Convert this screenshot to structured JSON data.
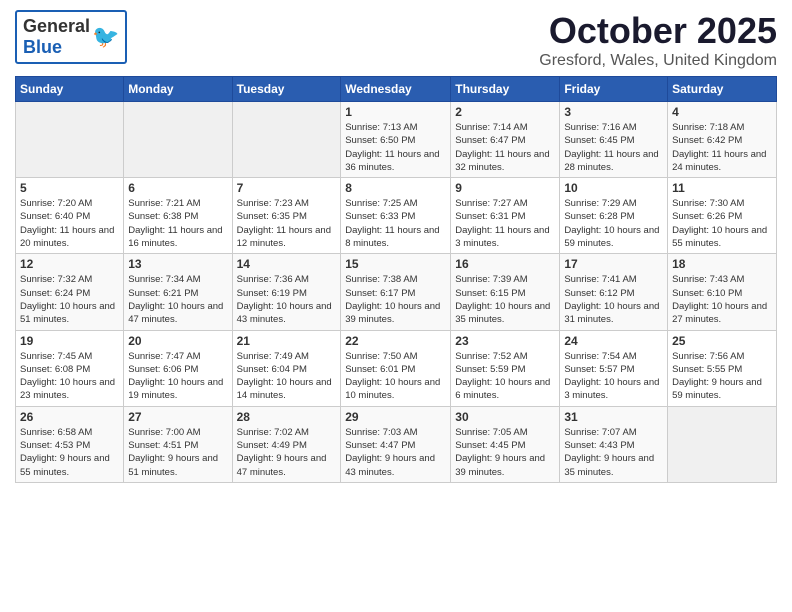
{
  "header": {
    "logo": {
      "general": "General",
      "blue": "Blue"
    },
    "title": "October 2025",
    "location": "Gresford, Wales, United Kingdom"
  },
  "weekdays": [
    "Sunday",
    "Monday",
    "Tuesday",
    "Wednesday",
    "Thursday",
    "Friday",
    "Saturday"
  ],
  "weeks": [
    [
      {
        "day": "",
        "empty": true
      },
      {
        "day": "",
        "empty": true
      },
      {
        "day": "",
        "empty": true
      },
      {
        "day": "1",
        "sunrise": "7:13 AM",
        "sunset": "6:50 PM",
        "daylight": "11 hours and 36 minutes."
      },
      {
        "day": "2",
        "sunrise": "7:14 AM",
        "sunset": "6:47 PM",
        "daylight": "11 hours and 32 minutes."
      },
      {
        "day": "3",
        "sunrise": "7:16 AM",
        "sunset": "6:45 PM",
        "daylight": "11 hours and 28 minutes."
      },
      {
        "day": "4",
        "sunrise": "7:18 AM",
        "sunset": "6:42 PM",
        "daylight": "11 hours and 24 minutes."
      }
    ],
    [
      {
        "day": "5",
        "sunrise": "7:20 AM",
        "sunset": "6:40 PM",
        "daylight": "11 hours and 20 minutes."
      },
      {
        "day": "6",
        "sunrise": "7:21 AM",
        "sunset": "6:38 PM",
        "daylight": "11 hours and 16 minutes."
      },
      {
        "day": "7",
        "sunrise": "7:23 AM",
        "sunset": "6:35 PM",
        "daylight": "11 hours and 12 minutes."
      },
      {
        "day": "8",
        "sunrise": "7:25 AM",
        "sunset": "6:33 PM",
        "daylight": "11 hours and 8 minutes."
      },
      {
        "day": "9",
        "sunrise": "7:27 AM",
        "sunset": "6:31 PM",
        "daylight": "11 hours and 3 minutes."
      },
      {
        "day": "10",
        "sunrise": "7:29 AM",
        "sunset": "6:28 PM",
        "daylight": "10 hours and 59 minutes."
      },
      {
        "day": "11",
        "sunrise": "7:30 AM",
        "sunset": "6:26 PM",
        "daylight": "10 hours and 55 minutes."
      }
    ],
    [
      {
        "day": "12",
        "sunrise": "7:32 AM",
        "sunset": "6:24 PM",
        "daylight": "10 hours and 51 minutes."
      },
      {
        "day": "13",
        "sunrise": "7:34 AM",
        "sunset": "6:21 PM",
        "daylight": "10 hours and 47 minutes."
      },
      {
        "day": "14",
        "sunrise": "7:36 AM",
        "sunset": "6:19 PM",
        "daylight": "10 hours and 43 minutes."
      },
      {
        "day": "15",
        "sunrise": "7:38 AM",
        "sunset": "6:17 PM",
        "daylight": "10 hours and 39 minutes."
      },
      {
        "day": "16",
        "sunrise": "7:39 AM",
        "sunset": "6:15 PM",
        "daylight": "10 hours and 35 minutes."
      },
      {
        "day": "17",
        "sunrise": "7:41 AM",
        "sunset": "6:12 PM",
        "daylight": "10 hours and 31 minutes."
      },
      {
        "day": "18",
        "sunrise": "7:43 AM",
        "sunset": "6:10 PM",
        "daylight": "10 hours and 27 minutes."
      }
    ],
    [
      {
        "day": "19",
        "sunrise": "7:45 AM",
        "sunset": "6:08 PM",
        "daylight": "10 hours and 23 minutes."
      },
      {
        "day": "20",
        "sunrise": "7:47 AM",
        "sunset": "6:06 PM",
        "daylight": "10 hours and 19 minutes."
      },
      {
        "day": "21",
        "sunrise": "7:49 AM",
        "sunset": "6:04 PM",
        "daylight": "10 hours and 14 minutes."
      },
      {
        "day": "22",
        "sunrise": "7:50 AM",
        "sunset": "6:01 PM",
        "daylight": "10 hours and 10 minutes."
      },
      {
        "day": "23",
        "sunrise": "7:52 AM",
        "sunset": "5:59 PM",
        "daylight": "10 hours and 6 minutes."
      },
      {
        "day": "24",
        "sunrise": "7:54 AM",
        "sunset": "5:57 PM",
        "daylight": "10 hours and 3 minutes."
      },
      {
        "day": "25",
        "sunrise": "7:56 AM",
        "sunset": "5:55 PM",
        "daylight": "9 hours and 59 minutes."
      }
    ],
    [
      {
        "day": "26",
        "sunrise": "6:58 AM",
        "sunset": "4:53 PM",
        "daylight": "9 hours and 55 minutes."
      },
      {
        "day": "27",
        "sunrise": "7:00 AM",
        "sunset": "4:51 PM",
        "daylight": "9 hours and 51 minutes."
      },
      {
        "day": "28",
        "sunrise": "7:02 AM",
        "sunset": "4:49 PM",
        "daylight": "9 hours and 47 minutes."
      },
      {
        "day": "29",
        "sunrise": "7:03 AM",
        "sunset": "4:47 PM",
        "daylight": "9 hours and 43 minutes."
      },
      {
        "day": "30",
        "sunrise": "7:05 AM",
        "sunset": "4:45 PM",
        "daylight": "9 hours and 39 minutes."
      },
      {
        "day": "31",
        "sunrise": "7:07 AM",
        "sunset": "4:43 PM",
        "daylight": "9 hours and 35 minutes."
      },
      {
        "day": "",
        "empty": true
      }
    ]
  ],
  "labels": {
    "sunrise": "Sunrise:",
    "sunset": "Sunset:",
    "daylight": "Daylight:"
  }
}
